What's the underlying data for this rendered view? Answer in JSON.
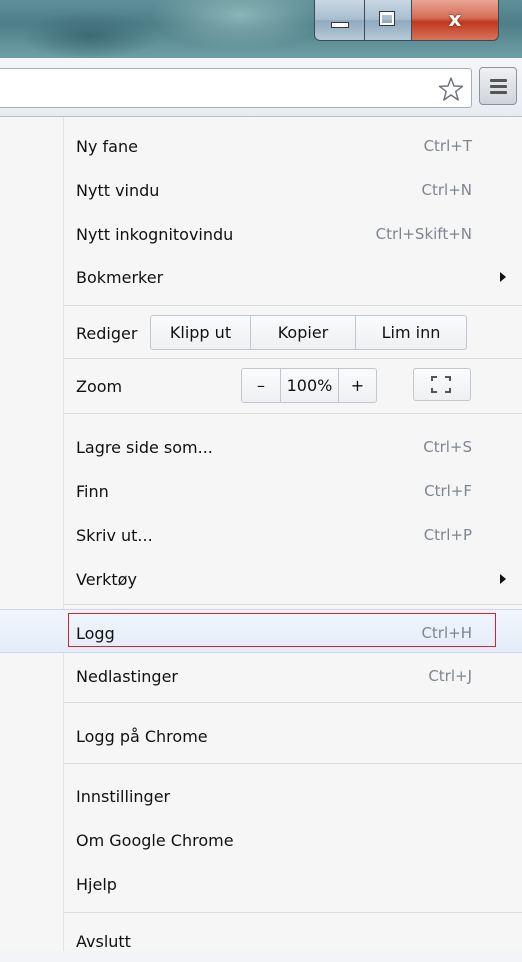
{
  "window": {
    "close_glyph": "x"
  },
  "toolbar": {
    "bookmark_icon": "star-outline-icon",
    "menu_icon": "hamburger-menu-icon"
  },
  "menu": {
    "new_tab": {
      "label": "Ny fane",
      "shortcut": "Ctrl+T"
    },
    "new_window": {
      "label": "Nytt vindu",
      "shortcut": "Ctrl+N"
    },
    "new_incognito": {
      "label": "Nytt inkognitovindu",
      "shortcut": "Ctrl+Skift+N"
    },
    "bookmarks": {
      "label": "Bokmerker"
    },
    "edit": {
      "label": "Rediger",
      "cut": "Klipp ut",
      "copy": "Kopier",
      "paste": "Lim inn"
    },
    "zoom": {
      "label": "Zoom",
      "minus": "–",
      "level": "100%",
      "plus": "+"
    },
    "save_page": {
      "label": "Lagre side som...",
      "shortcut": "Ctrl+S"
    },
    "find": {
      "label": "Finn",
      "shortcut": "Ctrl+F"
    },
    "print": {
      "label": "Skriv ut...",
      "shortcut": "Ctrl+P"
    },
    "tools": {
      "label": "Verktøy"
    },
    "history": {
      "label": "Logg",
      "shortcut": "Ctrl+H"
    },
    "downloads": {
      "label": "Nedlastinger",
      "shortcut": "Ctrl+J"
    },
    "sign_in": {
      "label": "Logg på Chrome"
    },
    "settings": {
      "label": "Innstillinger"
    },
    "about": {
      "label": "Om Google Chrome"
    },
    "help": {
      "label": "Hjelp"
    },
    "exit": {
      "label": "Avslutt"
    }
  },
  "colors": {
    "highlight_border": "#d9203a",
    "shortcut_text": "#7d8590"
  }
}
